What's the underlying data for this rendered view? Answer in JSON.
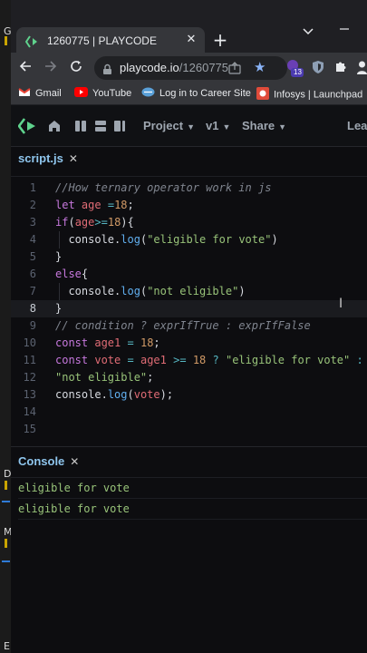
{
  "browser": {
    "tab_title": "1260775 | PLAYCODE",
    "url_host": "playcode.io",
    "url_path": "/1260775",
    "extension_badge": "13"
  },
  "bookmarks": [
    {
      "label": "Gmail",
      "icon": "gmail-icon"
    },
    {
      "label": "YouTube",
      "icon": "youtube-icon"
    },
    {
      "label": "Log in to Career Site",
      "icon": "career-site-icon"
    },
    {
      "label": "Infosys | Launchpad",
      "icon": "infosys-icon"
    }
  ],
  "playcode": {
    "menu_project": "Project",
    "menu_version": "v1",
    "menu_share": "Share",
    "menu_learn": "Lear"
  },
  "editor": {
    "file_tab": "script.js",
    "active_line": 8,
    "line_numbers": [
      "1",
      "2",
      "3",
      "4",
      "5",
      "6",
      "7",
      "8",
      "9",
      "10",
      "11",
      "12",
      "13",
      "14",
      "15"
    ],
    "code": [
      "//How ternary operator work in js",
      "let age =18;",
      "if(age>=18){",
      "  console.log(\"eligible for vote\")",
      "}",
      "else{",
      "  console.log(\"not eligible\")",
      "}",
      "// condition ? exprIfTrue : exprIfFalse",
      "const age1 = 18;",
      "const vote = age1 >= 18 ? \"eligible for vote\" :",
      "\"not eligible\";",
      "console.log(vote);",
      "",
      ""
    ]
  },
  "console": {
    "tab_label": "Console",
    "logs": [
      "eligible for vote",
      "eligible for vote"
    ]
  },
  "colors": {
    "accent": "#8fc6ee",
    "keyword": "#c678dd",
    "string": "#98c379",
    "number": "#d19a66",
    "function": "#61afef"
  }
}
